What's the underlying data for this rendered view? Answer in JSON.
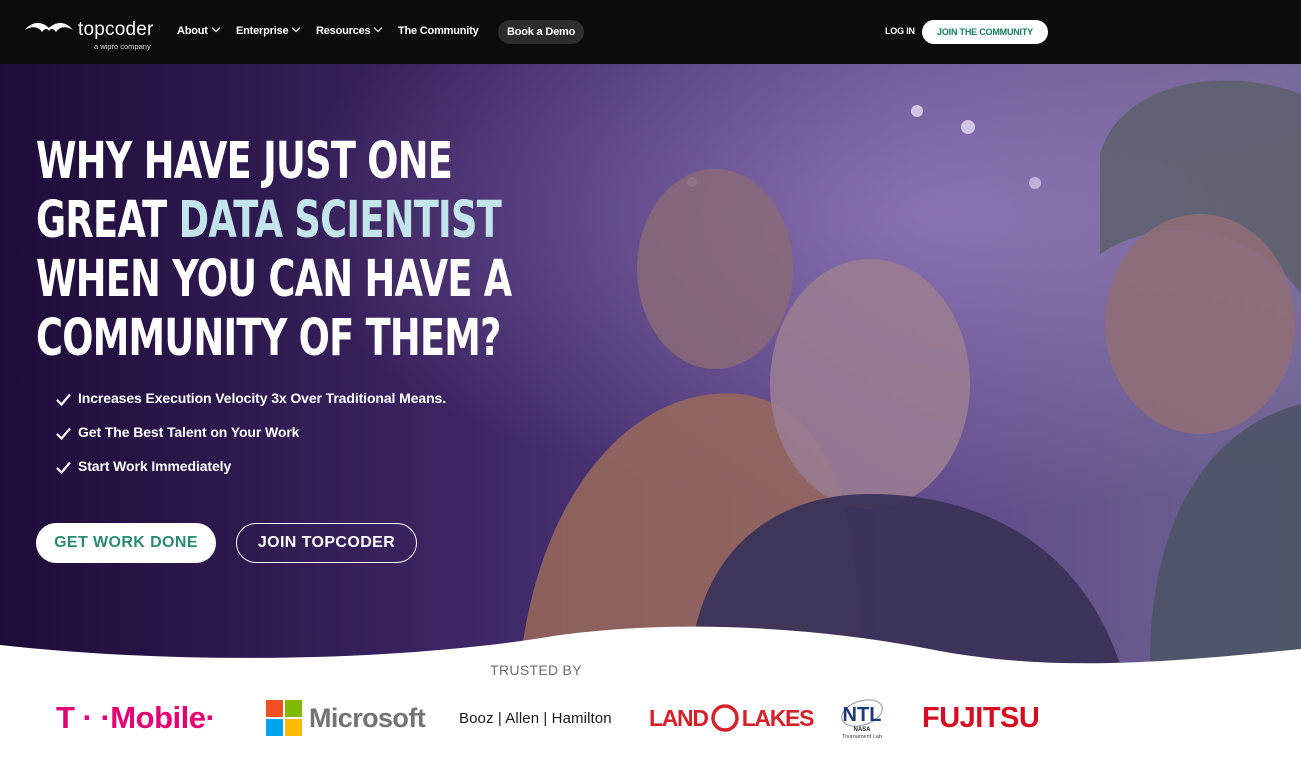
{
  "nav": {
    "logo_text": "topcoder",
    "logo_sub": "a wipro company",
    "items": [
      "About",
      "Enterprise",
      "Resources",
      "The Community"
    ],
    "demo_label": "Book a Demo",
    "login_label": "LOG IN",
    "join_label": "JOIN THE COMMUNITY"
  },
  "hero": {
    "title_line1": "WHY HAVE JUST ONE",
    "title_line2_pre": "GREAT ",
    "title_line2_highlight": "DATA SCIENTIST",
    "title_line3": "WHEN YOU CAN HAVE A",
    "title_line4": "COMMUNITY OF THEM?",
    "benefits": [
      "Increases Execution Velocity 3x Over Traditional Means.",
      "Get The Best Talent on Your Work",
      "Start Work Immediately"
    ],
    "primary_cta": "GET WORK DONE",
    "secondary_cta": "JOIN TOPCODER"
  },
  "trusted": {
    "title": "TRUSTED BY",
    "logos": {
      "tmobile": "T · ·Mobile·",
      "microsoft": "Microsoft",
      "booz": "Booz | Allen | Hamilton",
      "landolakes_left": "LAND",
      "landolakes_right": "LAKES",
      "ntl_mark": "NTL",
      "ntl_nasa": "NASA",
      "ntl_sub": "Tournament Lab",
      "fujitsu": "FUJITSU"
    }
  },
  "colors": {
    "accent_green": "#2c8b6e",
    "highlight": "#c4e4ec",
    "tmobile": "#e20074",
    "landolakes": "#d2232a",
    "fujitsu": "#d40e22"
  }
}
